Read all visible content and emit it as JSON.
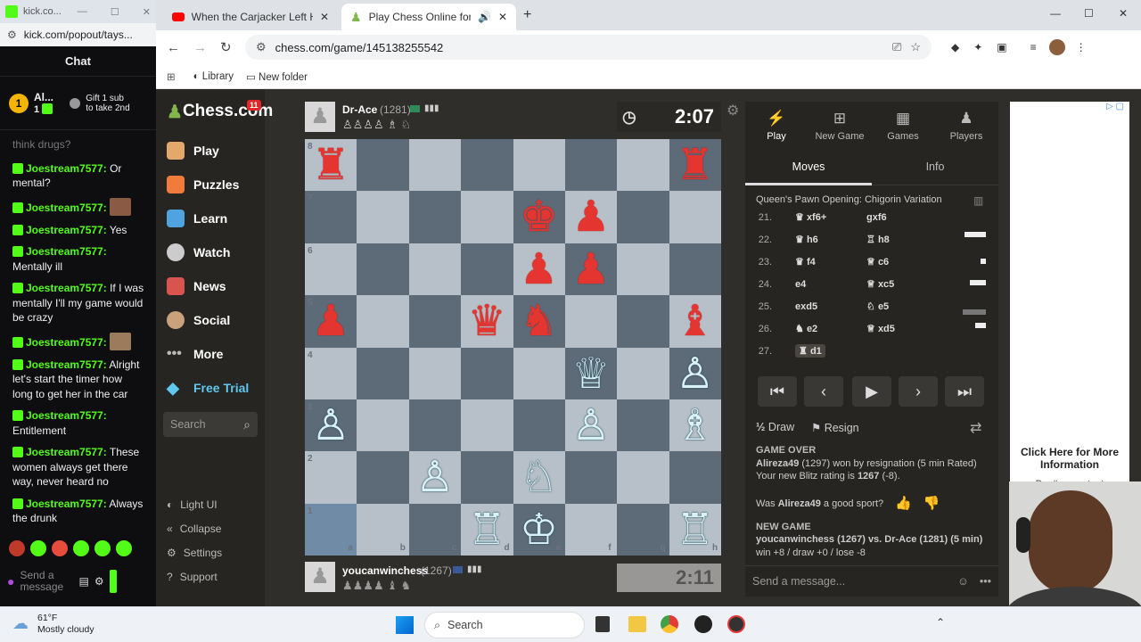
{
  "chat_window": {
    "title": "kick.co...",
    "url": "kick.com/popout/tays...",
    "header": "Chat",
    "top_user": "Al...",
    "top_user_count": "1",
    "gift_text": "Gift 1 sub to take 2nd",
    "first_msg_fragment": "think drugs?",
    "messages": [
      {
        "user": "Joestream7577:",
        "text": "Or mental?"
      },
      {
        "user": "Joestream7577:",
        "text": ""
      },
      {
        "user": "Joestream7577:",
        "text": "Yes"
      },
      {
        "user": "Joestream7577:",
        "text": "Mentally ill"
      },
      {
        "user": "Joestream7577:",
        "text": "If I was mentally I'll my game would be crazy"
      },
      {
        "user": "Joestream7577:",
        "text": ""
      },
      {
        "user": "Joestream7577:",
        "text": "Alright let's start the timer how long to get her in the car"
      },
      {
        "user": "Joestream7577:",
        "text": "Entitlement"
      },
      {
        "user": "Joestream7577:",
        "text": "These women always get there way, never heard no"
      },
      {
        "user": "Joestream7577:",
        "text": "Always the drunk"
      }
    ],
    "send_placeholder": "Send a message"
  },
  "browser": {
    "tabs": [
      {
        "label": "When the Carjacker Left His ID"
      },
      {
        "label": "Play Chess Online for FREE"
      }
    ],
    "url": "chess.com/game/145138255542",
    "bookmarks": [
      "Library",
      "New folder"
    ]
  },
  "chess_nav": {
    "logo": "Chess.com",
    "badge": "11",
    "items": [
      "Play",
      "Puzzles",
      "Learn",
      "Watch",
      "News",
      "Social",
      "More",
      "Free Trial"
    ],
    "search_placeholder": "Search",
    "bottom": [
      "Light UI",
      "Collapse",
      "Settings",
      "Support"
    ]
  },
  "top_player": {
    "name": "Dr-Ace",
    "rating": "(1281)",
    "clock": "2:07"
  },
  "bottom_player": {
    "name": "youcanwinchess",
    "rating": "(1267)",
    "clock": "2:11"
  },
  "board": {
    "ranks": [
      "8",
      "7",
      "6",
      "5",
      "4",
      "3",
      "2",
      "1"
    ],
    "files": [
      "a",
      "b",
      "c",
      "d",
      "e",
      "f",
      "g",
      "h"
    ],
    "pieces": [
      {
        "sq": "a8",
        "p": "♜",
        "c": "b"
      },
      {
        "sq": "h8",
        "p": "♜",
        "c": "b"
      },
      {
        "sq": "e7",
        "p": "♚",
        "c": "b"
      },
      {
        "sq": "f7",
        "p": "♟",
        "c": "b"
      },
      {
        "sq": "e6",
        "p": "♟",
        "c": "b"
      },
      {
        "sq": "f6",
        "p": "♟",
        "c": "b"
      },
      {
        "sq": "a5",
        "p": "♟",
        "c": "b"
      },
      {
        "sq": "d5",
        "p": "♛",
        "c": "b"
      },
      {
        "sq": "e5",
        "p": "♞",
        "c": "b"
      },
      {
        "sq": "h5",
        "p": "♝",
        "c": "b"
      },
      {
        "sq": "f4",
        "p": "♕",
        "c": "w"
      },
      {
        "sq": "h4",
        "p": "♙",
        "c": "w"
      },
      {
        "sq": "a3",
        "p": "♙",
        "c": "w"
      },
      {
        "sq": "f3",
        "p": "♙",
        "c": "w"
      },
      {
        "sq": "h3",
        "p": "♗",
        "c": "w"
      },
      {
        "sq": "c2",
        "p": "♙",
        "c": "w"
      },
      {
        "sq": "e2",
        "p": "♘",
        "c": "w"
      },
      {
        "sq": "d1",
        "p": "♖",
        "c": "w"
      },
      {
        "sq": "e1",
        "p": "♔",
        "c": "w"
      },
      {
        "sq": "h1",
        "p": "♖",
        "c": "w"
      }
    ],
    "highlight": [
      "a1"
    ],
    "light_color": "#b7c0c8",
    "dark_color": "#5d6a77"
  },
  "right_panel": {
    "tabs": [
      "Play",
      "New Game",
      "Games",
      "Players"
    ],
    "subtabs": [
      "Moves",
      "Info"
    ],
    "opening": "Queen's Pawn Opening: Chigorin Variation",
    "moves": [
      {
        "n": "21.",
        "w": "xf6+",
        "b": "gxf6"
      },
      {
        "n": "22.",
        "w": "h6",
        "b": "h8"
      },
      {
        "n": "23.",
        "w": "f4",
        "b": "c6"
      },
      {
        "n": "24.",
        "w": "e4",
        "b": "xc5"
      },
      {
        "n": "25.",
        "w": "exd5",
        "b": "e5"
      },
      {
        "n": "26.",
        "w": "e2",
        "b": "xd5"
      },
      {
        "n": "27.",
        "w": "d1",
        "b": ""
      }
    ],
    "draw": "Draw",
    "resign": "Resign",
    "game_over": "GAME OVER",
    "result_user": "Alireza49",
    "result_text": "(1297) won by resignation (5 min Rated)",
    "rating_line_pre": "Your new Blitz rating is",
    "rating_value": "1267",
    "rating_change": "(-8).",
    "sport_q_pre": "Was",
    "sport_q_user": "Alireza49",
    "sport_q_post": "a good sport?",
    "new_game": "NEW GAME",
    "new_game_line": "youcanwinchess (1267) vs. Dr-Ace (1281) (5 min)",
    "new_game_stakes": "win +8 / draw +0 / lose -8",
    "message_placeholder": "Send a message..."
  },
  "ad": {
    "headline": "Click Here for More Information",
    "sub": "Don't ... content"
  },
  "taskbar": {
    "weather_temp": "61°F",
    "weather_desc": "Mostly cloudy",
    "search": "Search"
  }
}
